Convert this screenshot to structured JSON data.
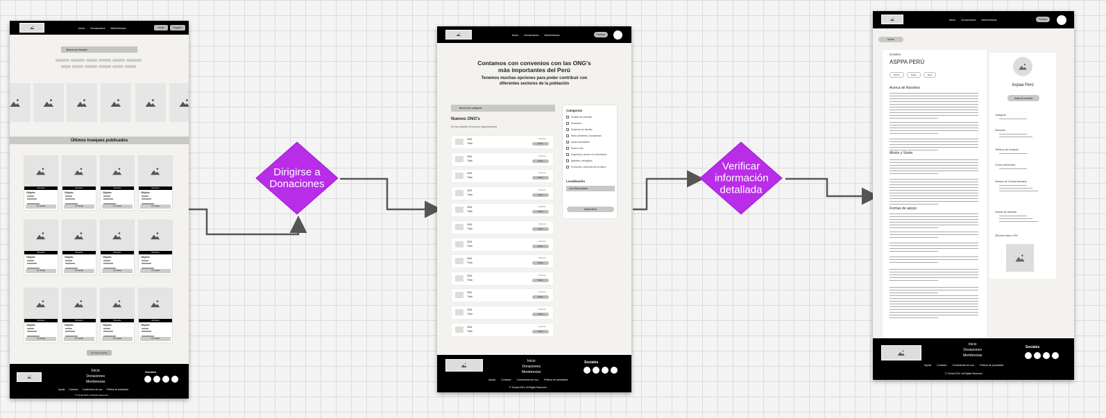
{
  "frame1": {
    "nav_links": [
      "Inicio",
      "Donaciones",
      "Membresías"
    ],
    "nav_buttons": [
      "Iniciar",
      "Registro"
    ],
    "search_placeholder": "Buscar por trueque",
    "filter_chips_row1": [
      "Electrónica",
      "Decoración",
      "Ropa",
      "Hogar",
      "Salud",
      "Accesorios"
    ],
    "filter_chips_row2": [
      "Muebles",
      "Juguetes",
      "Deportes",
      "Mascotas",
      "Libros",
      "Otros"
    ],
    "section_title": "Últimos trueques publicados",
    "card_label": "Ubicación",
    "card_title": "Objeto",
    "card_button": "Ver detalle",
    "more_button": "Ver más trueques",
    "footer_links": [
      "Inicio",
      "Donaciones",
      "Membresías"
    ],
    "footer_legal": [
      "Ayuda",
      "Contacto",
      "Condiciones de uso",
      "Política de privacidad"
    ],
    "footer_copy": "© Tuinda 2024. All Rights Reserved.",
    "footer_social": "Sociales"
  },
  "diamond1": {
    "text": "Dirigirse a Donaciones",
    "color": "#b92ce8"
  },
  "frame2": {
    "nav_links": [
      "Inicio",
      "Donaciones",
      "Membresías"
    ],
    "nav_button": "Publicar",
    "heading": "Contamos con convenios con las ONG's más importantes del Perú",
    "subheading": "Tenemos muchas opciones para poder contribuir con diferentes sectores de la población",
    "search_placeholder": "Buscar por categoría",
    "list_title": "Nuevos ONG's",
    "list_subtitle": "Se han añadido 15 nuevas organizaciones",
    "row_title": "ONG",
    "row_sub": "Título",
    "row_tag": "Ubicación",
    "row_button": "Donar",
    "categories_title": "Categorías",
    "categories": [
      "Cuidado de animales",
      "Educación",
      "Desarrollo de familias",
      "Medio ambiente y ecosistemas",
      "Ayuda humanitaria",
      "Salud y vida",
      "Seguridad y acceso a la información",
      "Igualdad y refugiados",
      "Promoción y derechos de la cultura"
    ],
    "location_title": "Localización",
    "location_value": "Lima Metropolitana",
    "apply_button": "Aplicar filtros",
    "footer_links": [
      "Inicio",
      "Donaciones",
      "Membresías"
    ],
    "footer_legal": [
      "Ayuda",
      "Contacto",
      "Condiciones de uso",
      "Política de privacidad"
    ],
    "footer_copy": "© Tuinda 2024. All Rights Reserved.",
    "footer_social": "Sociales"
  },
  "diamond2": {
    "text": "Verificar información detallada",
    "color": "#b92ce8"
  },
  "frame3": {
    "nav_links": [
      "Inicio",
      "Donaciones",
      "Membresías"
    ],
    "nav_button": "Publicar",
    "back_chip": "Volver",
    "details_label": "Detalles",
    "org_name": "ASPPA PERÚ",
    "tabs": [
      "Perros",
      "Gatos",
      "Aves"
    ],
    "about_title": "Acerca de Nosotros",
    "mission_title": "Misión y Visión",
    "ways_title": "Formas de apoyo",
    "side_name": "Aspaa Perú",
    "side_button": "Datos de contacto",
    "side_labels": [
      "Categoría",
      "Dirección",
      "Teléfono de Contacto",
      "Correo electrónico",
      "Número de Cuenta Bancaria",
      "Horario de atención",
      "QR para Yape o Plin"
    ],
    "footer_links": [
      "Inicio",
      "Donaciones",
      "Membresías"
    ],
    "footer_legal": [
      "Ayuda",
      "Contacto",
      "Condiciones de uso",
      "Política de privacidad"
    ],
    "footer_copy": "© Tuinda 2024. All Rights Reserved.",
    "footer_social": "Sociales"
  }
}
